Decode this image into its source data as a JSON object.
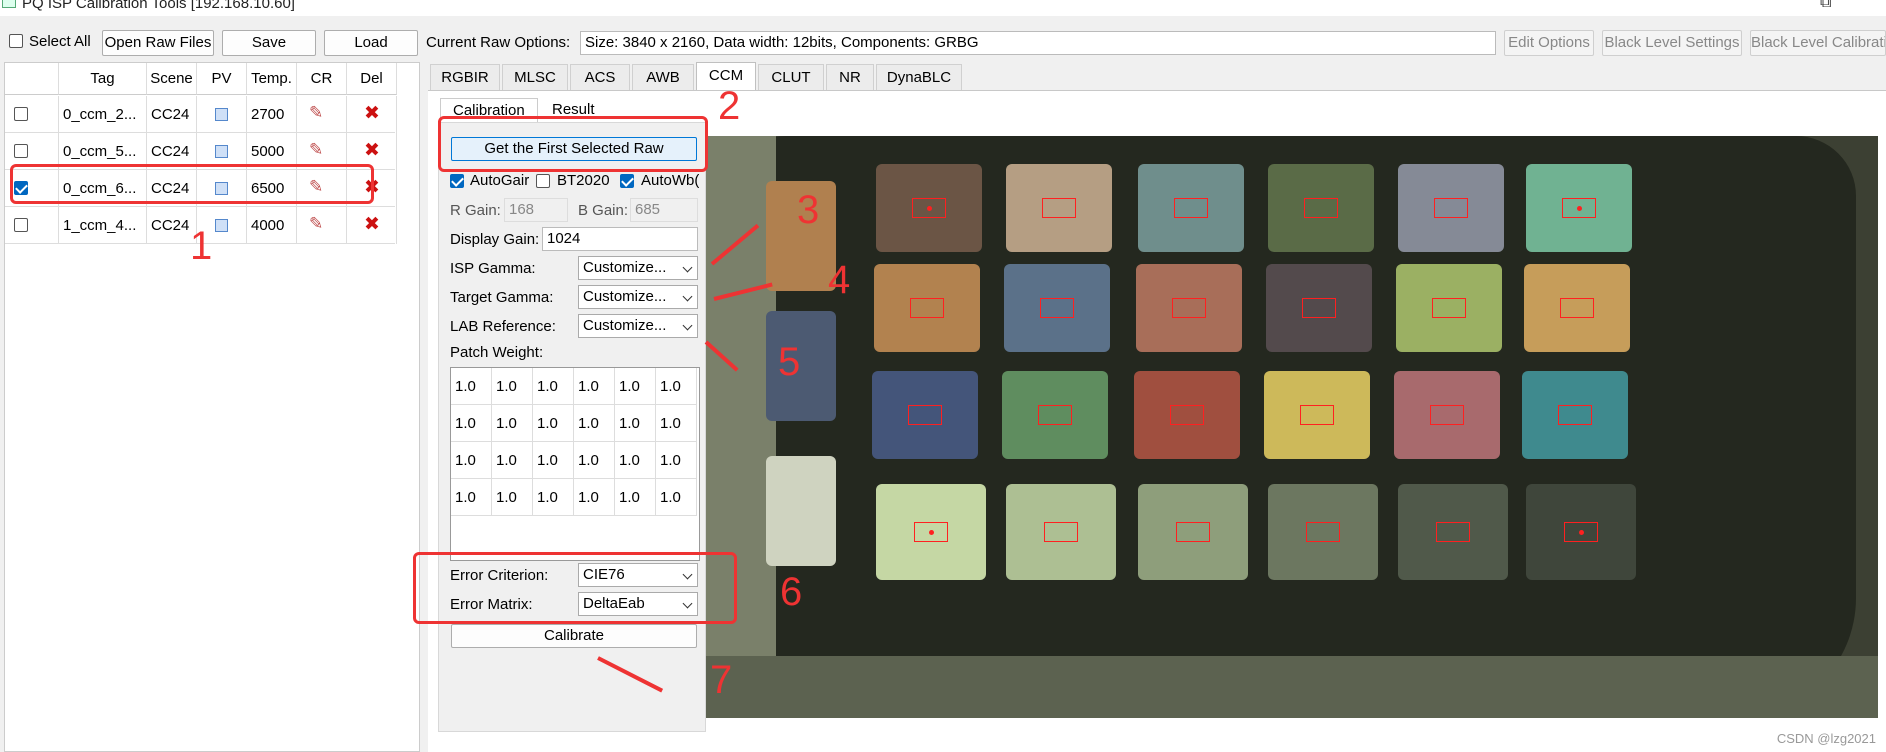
{
  "window": {
    "title": "PQ ISP Calibration Tools  [192.168.10.60]",
    "maximize_icon": "restore-icon",
    "minimize_icon": "minimize-icon"
  },
  "toolbar": {
    "select_all_label": "Select All",
    "select_all_checked": false,
    "open_raw_label": "Open Raw Files",
    "save_label": "Save",
    "load_label": "Load",
    "raw_options_label": "Current Raw Options:",
    "raw_options_value": "Size: 3840 x 2160, Data width: 12bits, Components: GRBG",
    "edit_options_label": "Edit Options",
    "black_level_settings_label": "Black Level Settings",
    "black_level_calib_label": "Black Level Calibration"
  },
  "raw_table": {
    "headers": [
      "Tag",
      "Scene",
      "PV",
      "Temp.",
      "CR",
      "Del"
    ],
    "rows": [
      {
        "checked": false,
        "tag": "0_ccm_2...",
        "scene": "CC24",
        "temp": "2700"
      },
      {
        "checked": false,
        "tag": "0_ccm_5...",
        "scene": "CC24",
        "temp": "5000"
      },
      {
        "checked": true,
        "tag": "0_ccm_6...",
        "scene": "CC24",
        "temp": "6500"
      },
      {
        "checked": false,
        "tag": "1_ccm_4...",
        "scene": "CC24",
        "temp": "4000"
      }
    ]
  },
  "tabs": [
    "RGBIR",
    "MLSC",
    "ACS",
    "AWB",
    "CCM",
    "CLUT",
    "NR",
    "DynaBLC"
  ],
  "selected_tab": "CCM",
  "subtabs": [
    "Calibration",
    "Result"
  ],
  "calibration": {
    "get_first_raw_label": "Get the First Selected Raw",
    "autogain_label": "AutoGair",
    "autogain_checked": true,
    "bt2020_label": "BT2020",
    "bt2020_checked": false,
    "autowb_label": "AutoWb(",
    "autowb_checked": true,
    "r_gain_label": "R Gain:",
    "r_gain_value": "168",
    "b_gain_label": "B Gain:",
    "b_gain_value": "685",
    "display_gain_label": "Display Gain:",
    "display_gain_value": "1024",
    "isp_gamma_label": "ISP Gamma:",
    "isp_gamma_value": "Customize...",
    "target_gamma_label": "Target Gamma:",
    "target_gamma_value": "Customize...",
    "lab_reference_label": "LAB Reference:",
    "lab_reference_value": "Customize...",
    "patch_weight_label": "Patch Weight:",
    "patch_weights": [
      [
        "1.0",
        "1.0",
        "1.0",
        "1.0",
        "1.0",
        "1.0"
      ],
      [
        "1.0",
        "1.0",
        "1.0",
        "1.0",
        "1.0",
        "1.0"
      ],
      [
        "1.0",
        "1.0",
        "1.0",
        "1.0",
        "1.0",
        "1.0"
      ],
      [
        "1.0",
        "1.0",
        "1.0",
        "1.0",
        "1.0",
        "1.0"
      ]
    ],
    "error_criterion_label": "Error Criterion:",
    "error_criterion_value": "CIE76",
    "error_matrix_label": "Error Matrix:",
    "error_matrix_value": "DeltaEab",
    "calibrate_label": "Calibrate"
  },
  "color_checker": {
    "patch_colors": [
      [
        "#6b5545",
        "#b59e83",
        "#6f8e8c",
        "#5a6b47",
        "#858a96",
        "#70b292"
      ],
      [
        "#b2824f",
        "#5b7189",
        "#a86e59",
        "#534a4c",
        "#9bb063",
        "#c69d5a"
      ],
      [
        "#44557a",
        "#5f8d5f",
        "#a04f3f",
        "#cdb95a",
        "#a86a6d",
        "#3f8a8e"
      ],
      [
        "#c5d7a4",
        "#adbf93",
        "#8e9e7b",
        "#6c7760",
        "#50594a",
        "#3f463b"
      ]
    ],
    "dot_patches": [
      [
        0,
        0
      ],
      [
        0,
        5
      ],
      [
        3,
        0
      ],
      [
        3,
        5
      ]
    ]
  },
  "annotations": [
    "1",
    "2",
    "3",
    "4",
    "5",
    "6",
    "7"
  ],
  "watermark": "CSDN @lzg2021"
}
